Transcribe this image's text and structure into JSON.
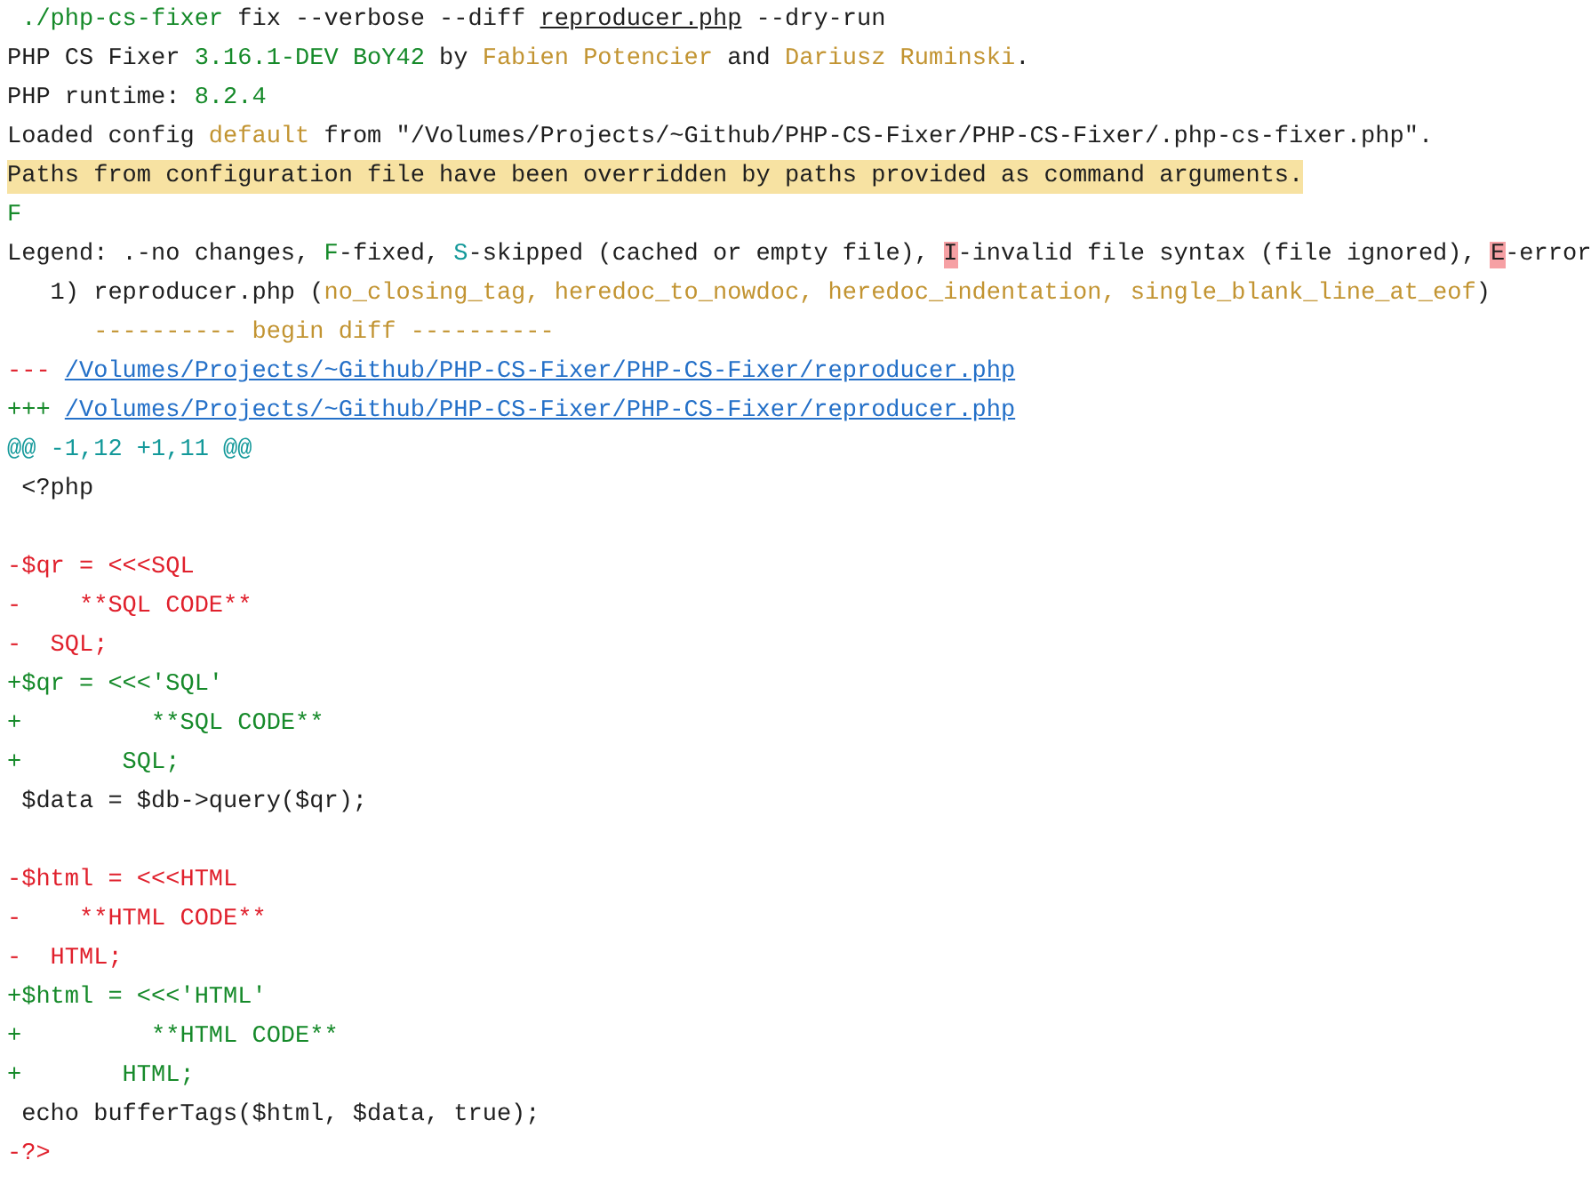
{
  "terminal": {
    "lines": [
      {
        "kind": "normal",
        "segments": [
          {
            "text": " ./php-cs-fixer",
            "kind": "green"
          },
          {
            "text": " fix --verbose --diff ",
            "kind": "plain"
          },
          {
            "text": "reproducer.php",
            "kind": "underline"
          },
          {
            "text": " --dry-run",
            "kind": "plain"
          }
        ]
      },
      {
        "kind": "normal",
        "segments": [
          {
            "text": "PHP CS Fixer ",
            "kind": "plain"
          },
          {
            "text": "3.16.1-DEV BoY42",
            "kind": "green"
          },
          {
            "text": " by ",
            "kind": "plain"
          },
          {
            "text": "Fabien Potencier",
            "kind": "gold"
          },
          {
            "text": " and ",
            "kind": "plain"
          },
          {
            "text": "Dariusz Ruminski",
            "kind": "gold"
          },
          {
            "text": ".",
            "kind": "plain"
          }
        ]
      },
      {
        "kind": "normal",
        "segments": [
          {
            "text": "PHP runtime: ",
            "kind": "plain"
          },
          {
            "text": "8.2.4",
            "kind": "green"
          }
        ]
      },
      {
        "kind": "normal",
        "segments": [
          {
            "text": "Loaded config ",
            "kind": "plain"
          },
          {
            "text": "default",
            "kind": "gold"
          },
          {
            "text": " from \"/Volumes/Projects/~Github/PHP-CS-Fixer/PHP-CS-Fixer/.php-cs-fixer.php\".",
            "kind": "plain"
          }
        ]
      },
      {
        "kind": "highlight",
        "segments": [
          {
            "text": "Paths from configuration file have been overridden by paths provided as command arguments.",
            "kind": "plain"
          }
        ]
      },
      {
        "kind": "normal",
        "segments": [
          {
            "text": "F",
            "kind": "green"
          }
        ]
      },
      {
        "kind": "normal",
        "segments": [
          {
            "text": "Legend: .-no changes, ",
            "kind": "plain"
          },
          {
            "text": "F",
            "kind": "green"
          },
          {
            "text": "-fixed, ",
            "kind": "plain"
          },
          {
            "text": "S",
            "kind": "teal"
          },
          {
            "text": "-skipped (cached or empty file), ",
            "kind": "plain"
          },
          {
            "text": "I",
            "kind": "flag"
          },
          {
            "text": "-invalid file syntax (file ignored), ",
            "kind": "plain"
          },
          {
            "text": "E",
            "kind": "flag"
          },
          {
            "text": "-error",
            "kind": "plain"
          }
        ]
      },
      {
        "kind": "normal",
        "segments": [
          {
            "text": "   1) reproducer.php (",
            "kind": "plain"
          },
          {
            "text": "no_closing_tag, heredoc_to_nowdoc, heredoc_indentation, single_blank_line_at_eof",
            "kind": "gold"
          },
          {
            "text": ")",
            "kind": "plain"
          }
        ]
      },
      {
        "kind": "normal",
        "segments": [
          {
            "text": "      ---------- begin diff ----------",
            "kind": "gold"
          }
        ]
      },
      {
        "kind": "normal",
        "segments": [
          {
            "text": "--- ",
            "kind": "red"
          },
          {
            "text": "/Volumes/Projects/~Github/PHP-CS-Fixer/PHP-CS-Fixer/reproducer.php",
            "kind": "link"
          }
        ]
      },
      {
        "kind": "normal",
        "segments": [
          {
            "text": "+++ ",
            "kind": "green"
          },
          {
            "text": "/Volumes/Projects/~Github/PHP-CS-Fixer/PHP-CS-Fixer/reproducer.php",
            "kind": "link"
          }
        ]
      },
      {
        "kind": "normal",
        "segments": [
          {
            "text": "@@ -1,12 +1,11 @@",
            "kind": "teal"
          }
        ]
      },
      {
        "kind": "normal",
        "segments": [
          {
            "text": " <?php",
            "kind": "plain"
          }
        ]
      },
      {
        "kind": "blank"
      },
      {
        "kind": "normal",
        "segments": [
          {
            "text": "-$qr = <<<SQL",
            "kind": "red"
          }
        ]
      },
      {
        "kind": "normal",
        "segments": [
          {
            "text": "-    **SQL CODE**",
            "kind": "red"
          }
        ]
      },
      {
        "kind": "normal",
        "segments": [
          {
            "text": "-  SQL;",
            "kind": "red"
          }
        ]
      },
      {
        "kind": "normal",
        "segments": [
          {
            "text": "+$qr = <<<'SQL'",
            "kind": "green"
          }
        ]
      },
      {
        "kind": "normal",
        "segments": [
          {
            "text": "+         **SQL CODE**",
            "kind": "green"
          }
        ]
      },
      {
        "kind": "normal",
        "segments": [
          {
            "text": "+       SQL;",
            "kind": "green"
          }
        ]
      },
      {
        "kind": "normal",
        "segments": [
          {
            "text": " $data = $db->query($qr);",
            "kind": "plain"
          }
        ]
      },
      {
        "kind": "blank"
      },
      {
        "kind": "normal",
        "segments": [
          {
            "text": "-$html = <<<HTML",
            "kind": "red"
          }
        ]
      },
      {
        "kind": "normal",
        "segments": [
          {
            "text": "-    **HTML CODE**",
            "kind": "red"
          }
        ]
      },
      {
        "kind": "normal",
        "segments": [
          {
            "text": "-  HTML;",
            "kind": "red"
          }
        ]
      },
      {
        "kind": "normal",
        "segments": [
          {
            "text": "+$html = <<<'HTML'",
            "kind": "green"
          }
        ]
      },
      {
        "kind": "normal",
        "segments": [
          {
            "text": "+         **HTML CODE**",
            "kind": "green"
          }
        ]
      },
      {
        "kind": "normal",
        "segments": [
          {
            "text": "+       HTML;",
            "kind": "green"
          }
        ]
      },
      {
        "kind": "normal",
        "segments": [
          {
            "text": " echo bufferTags($html, $data, true);",
            "kind": "plain"
          }
        ]
      },
      {
        "kind": "normal",
        "segments": [
          {
            "text": "-?>",
            "kind": "red"
          }
        ]
      }
    ]
  }
}
